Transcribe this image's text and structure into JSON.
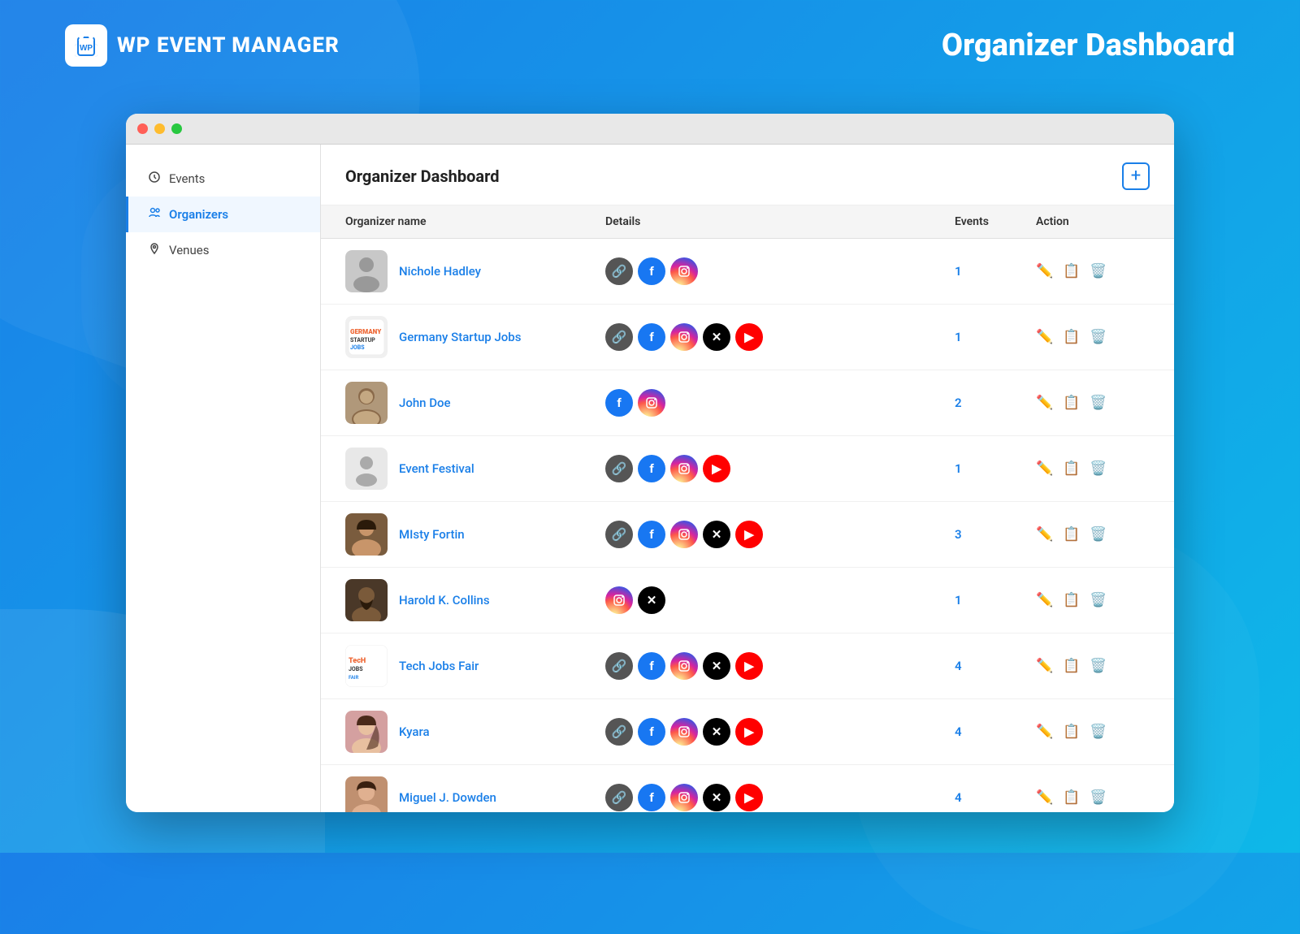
{
  "app": {
    "logo_text": "WP EVENT MANAGER",
    "header_title": "Organizer Dashboard"
  },
  "sidebar": {
    "items": [
      {
        "id": "events",
        "label": "Events",
        "icon": "📅",
        "active": false
      },
      {
        "id": "organizers",
        "label": "Organizers",
        "icon": "👥",
        "active": true
      },
      {
        "id": "venues",
        "label": "Venues",
        "icon": "📍",
        "active": false
      }
    ]
  },
  "main": {
    "title": "Organizer Dashboard",
    "add_button_label": "+",
    "table": {
      "headers": [
        "Organizer name",
        "Details",
        "Events",
        "Action"
      ],
      "rows": [
        {
          "name": "Nichole Hadley",
          "socials": [
            "link",
            "fb",
            "ig"
          ],
          "events": 1
        },
        {
          "name": "Germany Startup Jobs",
          "socials": [
            "link",
            "fb",
            "ig",
            "x",
            "yt"
          ],
          "events": 1
        },
        {
          "name": "John Doe",
          "socials": [
            "fb",
            "ig"
          ],
          "events": 2
        },
        {
          "name": "Event Festival",
          "socials": [
            "link",
            "fb",
            "ig",
            "yt"
          ],
          "events": 1
        },
        {
          "name": "MIsty Fortin",
          "socials": [
            "link",
            "fb",
            "ig",
            "x",
            "yt"
          ],
          "events": 3
        },
        {
          "name": "Harold K. Collins",
          "socials": [
            "ig",
            "x"
          ],
          "events": 1
        },
        {
          "name": "Tech Jobs Fair",
          "socials": [
            "link",
            "fb",
            "ig",
            "x",
            "yt"
          ],
          "events": 4
        },
        {
          "name": "Kyara",
          "socials": [
            "link",
            "fb",
            "ig",
            "x",
            "yt"
          ],
          "events": 4
        },
        {
          "name": "Miguel J. Dowden",
          "socials": [
            "link",
            "fb",
            "ig",
            "x",
            "yt"
          ],
          "events": 4
        }
      ]
    }
  },
  "colors": {
    "primary": "#1a7fe8",
    "background_gradient_start": "#1a7fe8",
    "background_gradient_end": "#0eb8e8"
  }
}
